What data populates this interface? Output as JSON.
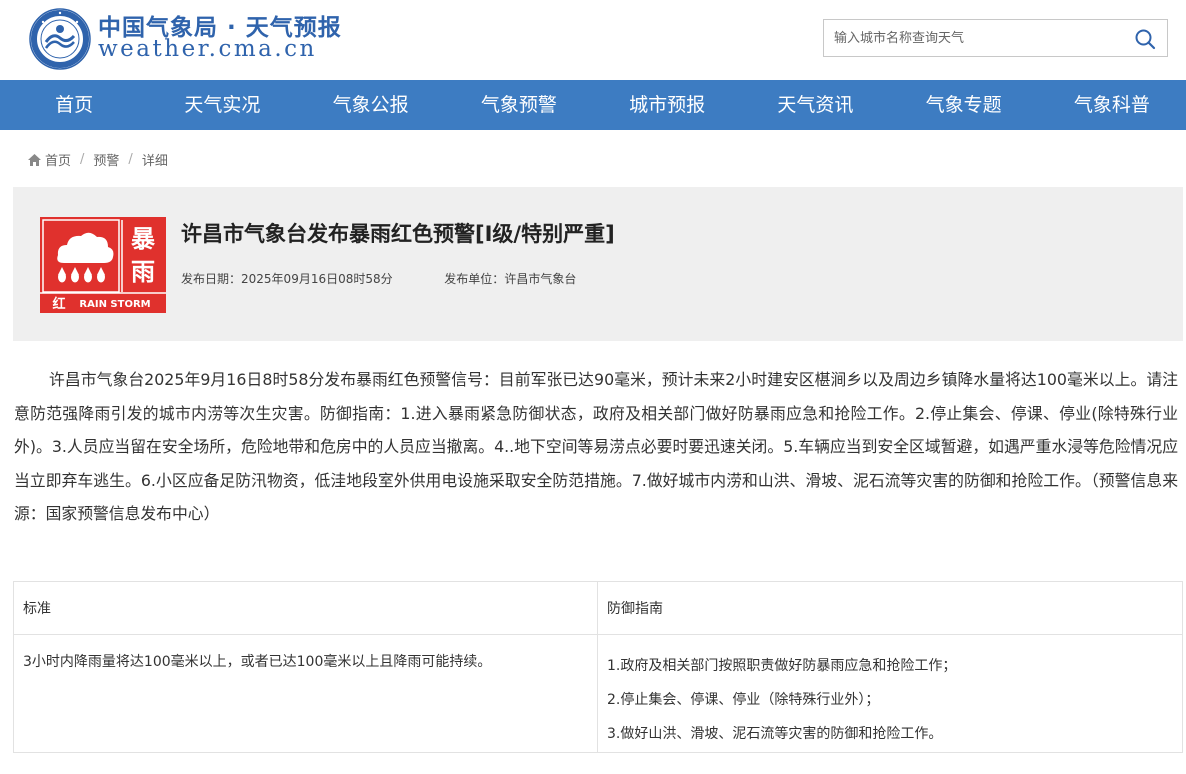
{
  "header": {
    "site_name": "中国气象局 · 天气预报",
    "site_domain": "weather.cma.cn",
    "search_placeholder": "输入城市名称查询天气",
    "logo_icon": "cma-emblem-icon",
    "search_icon": "search-icon"
  },
  "nav": {
    "items": [
      "首页",
      "天气实况",
      "气象公报",
      "气象预警",
      "城市预报",
      "天气资讯",
      "气象专题",
      "气象科普"
    ],
    "background": "#3d7cc2"
  },
  "breadcrumb": {
    "items": [
      "首页",
      "预警",
      "详细"
    ],
    "separator": "/"
  },
  "alert": {
    "icon": {
      "name": "rainstorm-red-warning-icon",
      "char_1": "暴",
      "char_2": "雨",
      "level_char": "红",
      "english": "RAIN STORM",
      "color": "#e0312d"
    },
    "title": "许昌市气象台发布暴雨红色预警[Ⅰ级/特别严重]",
    "publish_date_label": "发布日期：",
    "publish_date": "2025年09月16日08时58分",
    "publisher_label": "发布单位：",
    "publisher": "许昌市气象台"
  },
  "content": {
    "text": "许昌市气象台2025年9月16日8时58分发布暴雨红色预警信号：目前军张已达90毫米，预计未来2小时建安区椹涧乡以及周边乡镇降水量将达100毫米以上。请注意防范强降雨引发的城市内涝等次生灾害。防御指南：1.进入暴雨紧急防御状态，政府及相关部门做好防暴雨应急和抢险工作。2.停止集会、停课、停业(除特殊行业外)。3.人员应当留在安全场所，危险地带和危房中的人员应当撤离。4..地下空间等易涝点必要时要迅速关闭。5.车辆应当到安全区域暂避，如遇严重水浸等危险情况应当立即弃车逃生。6.小区应备足防汛物资，低洼地段室外供用电设施采取安全防范措施。7.做好城市内涝和山洪、滑坡、泥石流等灾害的防御和抢险工作。（预警信息来源：国家预警信息发布中心）"
  },
  "table": {
    "headers": [
      "标准",
      "防御指南"
    ],
    "standard": "3小时内降雨量将达100毫米以上，或者已达100毫米以上且降雨可能持续。",
    "guidelines": [
      "1.政府及相关部门按照职责做好防暴雨应急和抢险工作；",
      "2.停止集会、停课、停业（除特殊行业外）；",
      "3.做好山洪、滑坡、泥石流等灾害的防御和抢险工作。"
    ]
  }
}
